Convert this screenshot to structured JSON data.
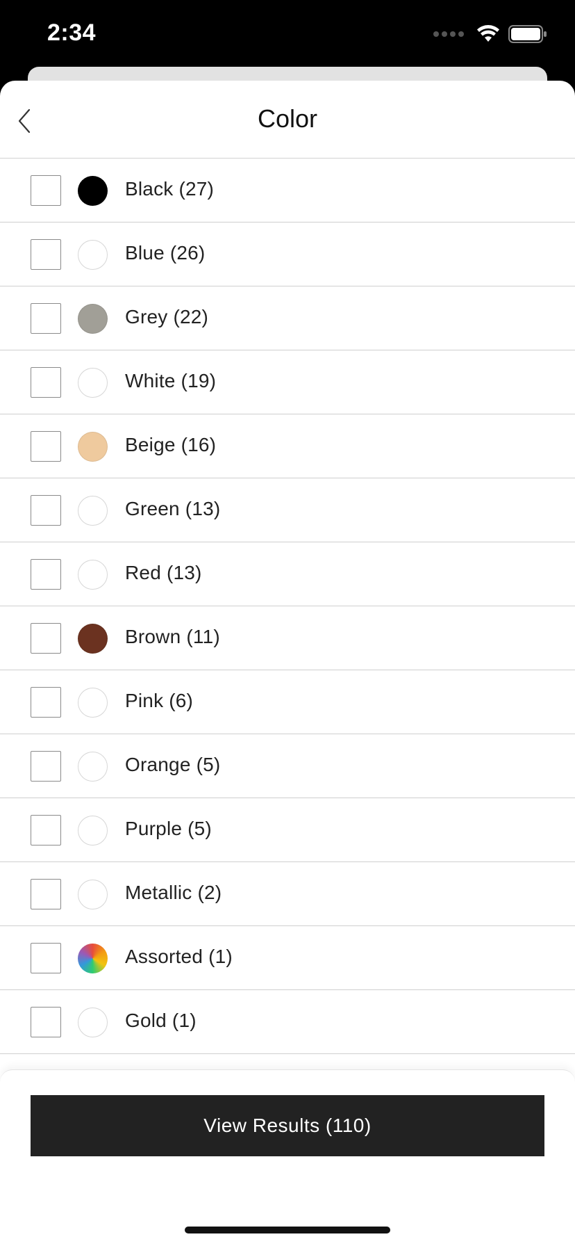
{
  "status_bar": {
    "time": "2:34",
    "icons": [
      "cellular-signal-icon",
      "wifi-icon",
      "battery-icon"
    ]
  },
  "header": {
    "title": "Color",
    "back_icon": "chevron-left-icon"
  },
  "colors": {
    "swatch_border": "#d6d6d6",
    "button_bg": "#222222",
    "button_text": "#ffffff"
  },
  "options": [
    {
      "label": "Black (27)",
      "swatch": "#000000",
      "checked": false
    },
    {
      "label": "Blue (26)",
      "swatch": "#ffffff",
      "checked": false
    },
    {
      "label": "Grey (22)",
      "swatch": "#a19f97",
      "checked": false
    },
    {
      "label": "White (19)",
      "swatch": "#ffffff",
      "checked": false
    },
    {
      "label": "Beige (16)",
      "swatch": "#efca9e",
      "checked": false
    },
    {
      "label": "Green (13)",
      "swatch": "#ffffff",
      "checked": false
    },
    {
      "label": "Red (13)",
      "swatch": "#ffffff",
      "checked": false
    },
    {
      "label": "Brown (11)",
      "swatch": "#6b3220",
      "checked": false
    },
    {
      "label": "Pink (6)",
      "swatch": "#ffffff",
      "checked": false
    },
    {
      "label": "Orange (5)",
      "swatch": "#ffffff",
      "checked": false
    },
    {
      "label": "Purple (5)",
      "swatch": "#ffffff",
      "checked": false
    },
    {
      "label": "Metallic (2)",
      "swatch": "#ffffff",
      "checked": false
    },
    {
      "label": "Assorted (1)",
      "swatch": "multicolor",
      "checked": false
    },
    {
      "label": "Gold (1)",
      "swatch": "#ffffff",
      "checked": false
    }
  ],
  "footer": {
    "view_results_label": "View Results (110)"
  }
}
